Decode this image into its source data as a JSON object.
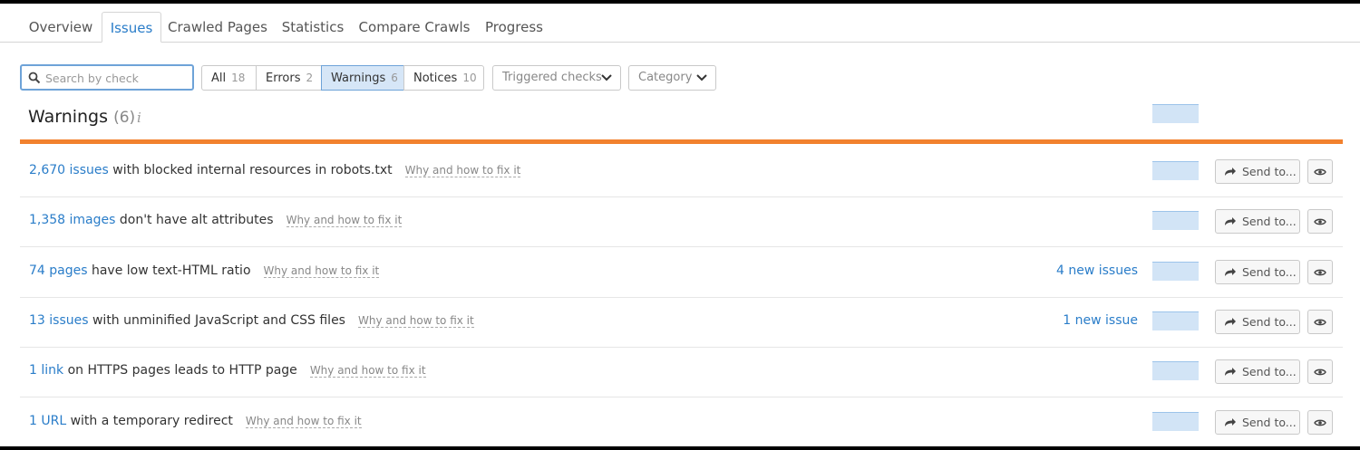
{
  "tabs": [
    "Overview",
    "Issues",
    "Crawled Pages",
    "Statistics",
    "Compare Crawls",
    "Progress"
  ],
  "active_tab": "Issues",
  "search": {
    "placeholder": "Search by check",
    "value": ""
  },
  "filters": [
    {
      "label": "All",
      "count": "18"
    },
    {
      "label": "Errors",
      "count": "2"
    },
    {
      "label": "Warnings",
      "count": "6"
    },
    {
      "label": "Notices",
      "count": "10"
    }
  ],
  "active_filter": "Warnings",
  "dropdowns": {
    "triggered": "Triggered checks",
    "category": "Category"
  },
  "section": {
    "title": "Warnings",
    "count": "(6)",
    "info_glyph": "i"
  },
  "colors": {
    "accent": "#2a7dc9",
    "warning_bar": "#f2812e",
    "active_filter_bg": "#d6e6f7",
    "sparkline": "#d2e4f6"
  },
  "icons": [
    "search-icon",
    "chevron-down-icon",
    "info-icon",
    "share-arrow-icon",
    "eye-icon"
  ],
  "rows": [
    {
      "lead": "2,670 issues",
      "rest": " with blocked internal resources in robots.txt",
      "why": "Why and how to fix it",
      "new": "",
      "send": "Send to..."
    },
    {
      "lead": "1,358 images",
      "rest": " don't have alt attributes",
      "why": "Why and how to fix it",
      "new": "",
      "send": "Send to..."
    },
    {
      "lead": "74 pages",
      "rest": " have low text-HTML ratio",
      "why": "Why and how to fix it",
      "new": "4 new issues",
      "send": "Send to..."
    },
    {
      "lead": "13 issues",
      "rest": " with unminified JavaScript and CSS files",
      "why": "Why and how to fix it",
      "new": "1 new issue",
      "send": "Send to..."
    },
    {
      "lead": "1 link",
      "rest": " on HTTPS pages leads to HTTP page",
      "why": "Why and how to fix it",
      "new": "",
      "send": "Send to..."
    },
    {
      "lead": "1 URL",
      "rest": " with a temporary redirect",
      "why": "Why and how to fix it",
      "new": "",
      "send": "Send to..."
    }
  ]
}
